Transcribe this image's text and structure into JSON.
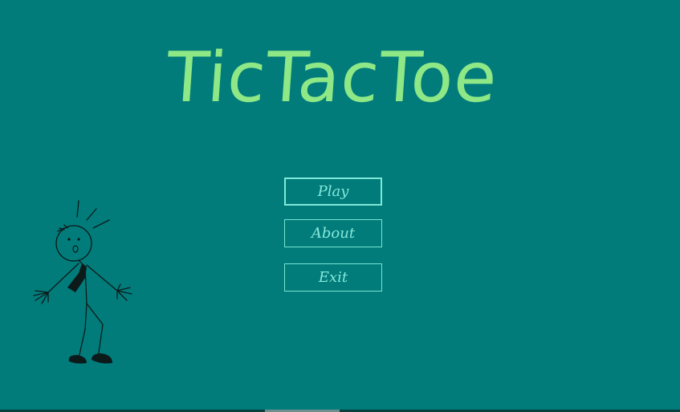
{
  "app": {
    "title": "TicTacToe",
    "background_color": "#017c7b",
    "title_color": "#8ee886",
    "button_color": "#86e8da"
  },
  "menu": {
    "play_label": "Play",
    "about_label": "About",
    "exit_label": "Exit"
  },
  "illustration": {
    "icon": "stickman-icon"
  }
}
